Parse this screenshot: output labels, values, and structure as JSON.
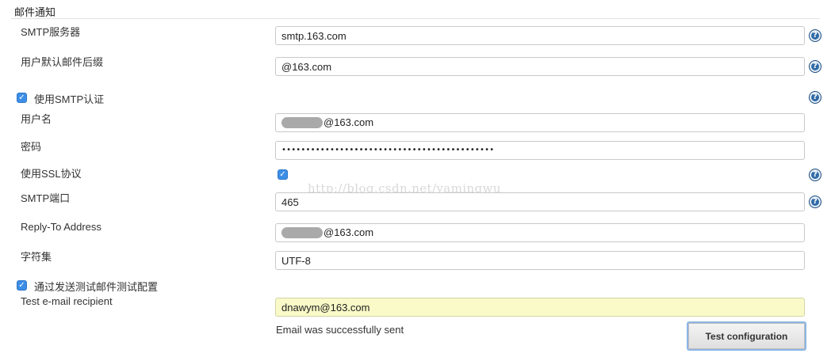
{
  "section": {
    "title": "邮件通知"
  },
  "fields": {
    "smtp_server": {
      "label": "SMTP服务器",
      "value": "smtp.163.com"
    },
    "default_suffix": {
      "label": "用户默认邮件后缀",
      "value": "@163.com"
    },
    "use_smtp_auth": {
      "label": "使用SMTP认证",
      "checked": true
    },
    "username": {
      "label": "用户名",
      "value_visible": "@163.com"
    },
    "password": {
      "label": "密码",
      "value": "••••••••••••••••••••••••••••••••••••••••••••"
    },
    "use_ssl": {
      "label": "使用SSL协议",
      "checked": true
    },
    "smtp_port": {
      "label": "SMTP端口",
      "value": "465"
    },
    "reply_to": {
      "label": "Reply-To Address",
      "value_visible": "@163.com"
    },
    "charset": {
      "label": "字符集",
      "value": "UTF-8"
    },
    "test_by_send": {
      "label": "通过发送测试邮件测试配置",
      "checked": true
    },
    "test_recipient": {
      "label": "Test e-mail recipient",
      "value": "dnawym@163.com"
    }
  },
  "watermark": "http://blog.csdn.net/yamingwu",
  "status_message": "Email was successfully sent",
  "buttons": {
    "test_configuration": "Test configuration"
  },
  "icons": {
    "help": "help-icon",
    "checkbox": "checkbox-checked"
  },
  "colors": {
    "accent": "#3d8ee6",
    "help": "#2f6aa8",
    "recipient_bg": "#fafac8"
  }
}
